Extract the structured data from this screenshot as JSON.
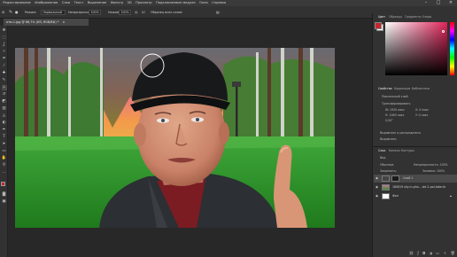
{
  "menu": {
    "items": [
      "Редактирование",
      "Изображение",
      "Слои",
      "Текст",
      "Выделение",
      "Фильтр",
      "3D",
      "Просмотр",
      "Подключаемые модули",
      "Окно",
      "Справка"
    ]
  },
  "options": {
    "mode_label": "Режим:",
    "mode_value": "Нормальный",
    "opacity_label": "Непрозрачность:",
    "opacity_value": "100%",
    "flow_label": "Нажим:",
    "flow_value": "100%",
    "sample_label": "Образец всех слоев"
  },
  "document": {
    "tab_title": "отм-1.jpg @ 66,7% (ИЗ, RGB/8#) *"
  },
  "panels": {
    "color_tabs": [
      "Цвет",
      "Образцы",
      "Градиенты",
      "Узоры"
    ],
    "properties_tabs": [
      "Свойства",
      "Коррекция",
      "Библиотеки"
    ],
    "properties_title": "Пиксельный слой",
    "transform_label": "Трансформировать",
    "transform_w": "W: 1920 пикс",
    "transform_h": "H: 1080 пикс",
    "transform_x": "X: 0 пикс",
    "transform_y": "Y: 0 пикс",
    "transform_angle": "0,00°",
    "align_label": "Выровнять и распределить",
    "align_sub": "Выровнять:",
    "layers_tabs": [
      "Слои",
      "Каналы",
      "Контуры"
    ],
    "kind_label": "Вид",
    "blend_label": "Обычные",
    "opacity_label": "Непрозрачность: 100%",
    "lock_label": "Закрепить:",
    "fill_label": "Заливка: 100%"
  },
  "layers": [
    {
      "name": "Слой 1",
      "selected": true
    },
    {
      "name": "180819 sky-in-pho... ole-2-pol-tabe-fo",
      "selected": false
    },
    {
      "name": "Фон",
      "selected": false
    }
  ],
  "colors": {
    "foreground": "#c4262a",
    "background": "#ffffff",
    "picker_hue": "#e0245a"
  }
}
